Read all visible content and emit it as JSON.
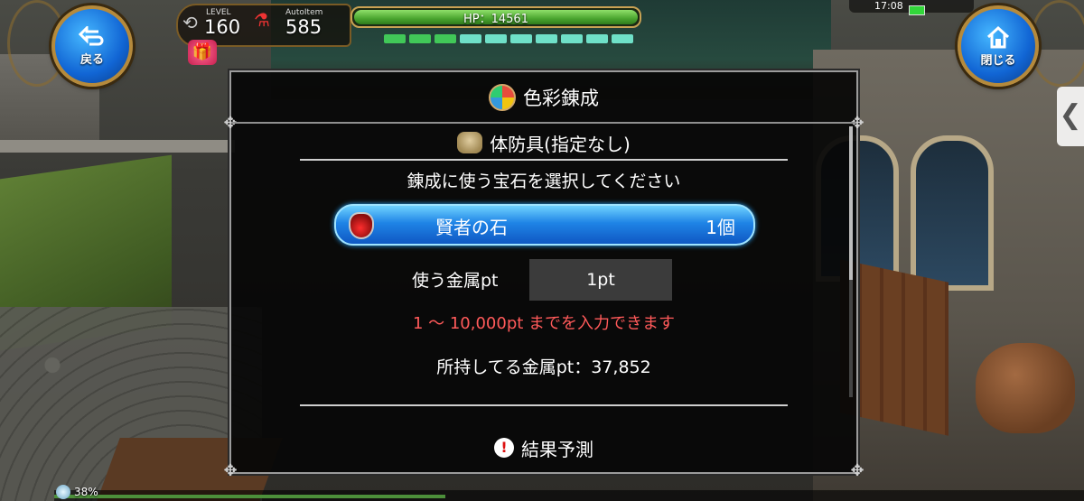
{
  "hud": {
    "back_label": "戻る",
    "close_label": "閉じる",
    "level_label": "LEVEL",
    "level_value": "160",
    "autoitem_label": "AutoItem",
    "autoitem_value": "585",
    "hp_text": "HP：14561",
    "hp_fraction": 1.0,
    "segments_green": 3,
    "segments_total": 10,
    "clock": "17:08",
    "xp_text": "38%",
    "xp_fraction": 0.38,
    "side_arrow": "❮"
  },
  "dialog": {
    "title": "色彩錬成",
    "subtitle": "体防具(指定なし)",
    "instruction": "錬成に使う宝石を選択してください",
    "gem_name": "賢者の石",
    "gem_count": "1個",
    "metal_label": "使う金属pt",
    "metal_value": "1pt",
    "range_text": "1 〜 10,000pt までを入力できます",
    "owned_text": "所持してる金属pt：37,852",
    "predict_label": "結果予測"
  },
  "colors": {
    "accent_blue": "#1f84e6",
    "warning_red": "#ff5a5a",
    "hp_green": "#4aa52f"
  }
}
